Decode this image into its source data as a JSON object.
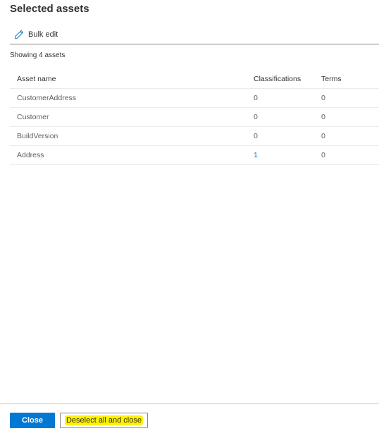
{
  "panel": {
    "title": "Selected assets",
    "toolbar": {
      "bulk_edit_label": "Bulk edit",
      "bulk_edit_icon": "pencil-icon"
    },
    "count_text": "Showing 4 assets"
  },
  "table": {
    "headers": {
      "asset_name": "Asset name",
      "classifications": "Classifications",
      "terms": "Terms"
    },
    "rows": [
      {
        "asset_name": "CustomerAddress",
        "classifications": "0",
        "terms": "0"
      },
      {
        "asset_name": "Customer",
        "classifications": "0",
        "terms": "0"
      },
      {
        "asset_name": "BuildVersion",
        "classifications": "0",
        "terms": "0"
      },
      {
        "asset_name": "Address",
        "classifications": "1",
        "terms": "0"
      }
    ]
  },
  "footer": {
    "close_label": "Close",
    "deselect_label": "Deselect all and close"
  },
  "colors": {
    "accent": "#0078d4",
    "highlight": "#fff200"
  }
}
